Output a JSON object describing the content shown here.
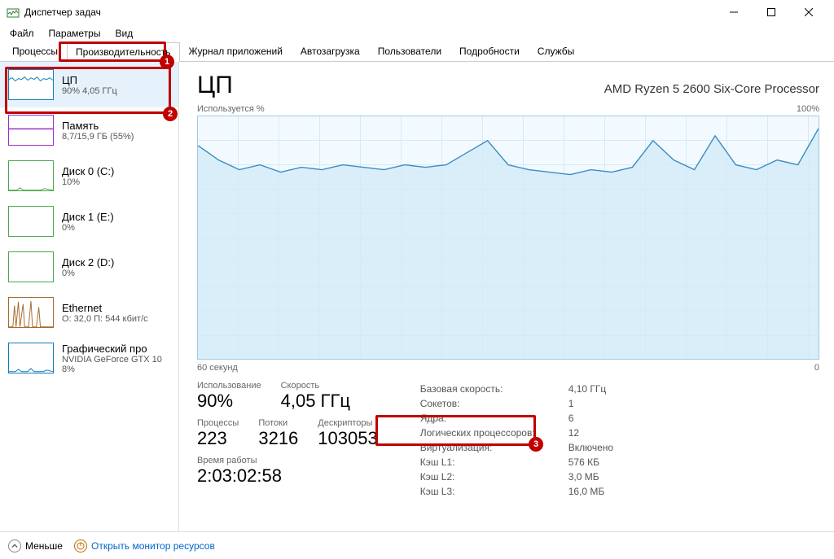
{
  "window": {
    "title": "Диспетчер задач"
  },
  "menu": {
    "file": "Файл",
    "params": "Параметры",
    "view": "Вид"
  },
  "tabs": {
    "processes": "Процессы",
    "performance": "Производительность",
    "apphistory": "Журнал приложений",
    "startup": "Автозагрузка",
    "users": "Пользователи",
    "details": "Подробности",
    "services": "Службы"
  },
  "sidebar": {
    "cpu": {
      "title": "ЦП",
      "sub": "90% 4,05 ГГц"
    },
    "mem": {
      "title": "Память",
      "sub": "8,7/15,9 ГБ (55%)"
    },
    "disk0": {
      "title": "Диск 0 (C:)",
      "sub": "10%"
    },
    "disk1": {
      "title": "Диск 1 (E:)",
      "sub": "0%"
    },
    "disk2": {
      "title": "Диск 2 (D:)",
      "sub": "0%"
    },
    "eth": {
      "title": "Ethernet",
      "sub": "О: 32,0 П: 544 кбит/с"
    },
    "gpu": {
      "title": "Графический про",
      "sub": "NVIDIA GeForce GTX 10",
      "sub2": "8%"
    }
  },
  "main": {
    "title": "ЦП",
    "model": "AMD Ryzen 5 2600 Six-Core Processor",
    "chart_tl": "Используется %",
    "chart_tr": "100%",
    "chart_bl": "60 секунд",
    "chart_br": "0",
    "stats_left": {
      "usage_label": "Использование",
      "usage_value": "90%",
      "speed_label": "Скорость",
      "speed_value": "4,05 ГГц",
      "procs_label": "Процессы",
      "procs_value": "223",
      "threads_label": "Потоки",
      "threads_value": "3216",
      "handles_label": "Дескрипторы",
      "handles_value": "103053",
      "uptime_label": "Время работы",
      "uptime_value": "2:03:02:58"
    },
    "stats_right": {
      "base_l": "Базовая скорость:",
      "base_v": "4,10 ГГц",
      "sockets_l": "Сокетов:",
      "sockets_v": "1",
      "cores_l": "Ядра:",
      "cores_v": "6",
      "logical_l": "Логических процессоров:",
      "logical_v": "12",
      "virt_l": "Виртуализация:",
      "virt_v": "Включено",
      "l1_l": "Кэш L1:",
      "l1_v": "576 КБ",
      "l2_l": "Кэш L2:",
      "l2_v": "3,0 МБ",
      "l3_l": "Кэш L3:",
      "l3_v": "16,0 МБ"
    }
  },
  "footer": {
    "less": "Меньше",
    "resmon": "Открыть монитор ресурсов"
  },
  "annotations": {
    "b1": "1",
    "b2": "2",
    "b3": "3"
  },
  "chart_data": {
    "type": "line",
    "title": "Используется %",
    "xlabel": "60 секунд",
    "ylabel": "%",
    "ylim": [
      0,
      100
    ],
    "x": [
      0,
      2,
      4,
      6,
      8,
      10,
      12,
      14,
      16,
      18,
      20,
      22,
      24,
      26,
      28,
      30,
      32,
      34,
      36,
      38,
      40,
      42,
      44,
      46,
      48,
      50,
      52,
      54,
      56,
      58,
      60
    ],
    "values": [
      88,
      82,
      78,
      80,
      77,
      79,
      78,
      80,
      79,
      78,
      80,
      79,
      80,
      85,
      90,
      80,
      78,
      77,
      76,
      78,
      77,
      79,
      90,
      82,
      78,
      92,
      80,
      78,
      82,
      80,
      95
    ]
  }
}
